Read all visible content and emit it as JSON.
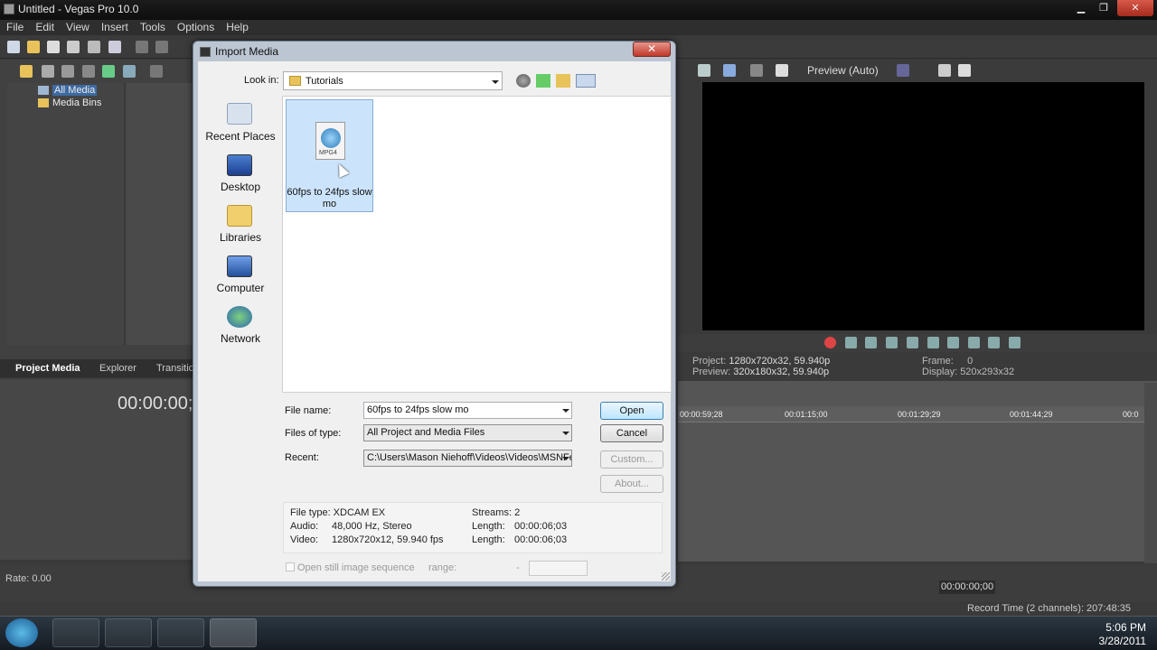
{
  "app": {
    "title": "Untitled - Vegas Pro 10.0"
  },
  "menu": [
    "File",
    "Edit",
    "View",
    "Insert",
    "Tools",
    "Options",
    "Help"
  ],
  "left_panel": {
    "tree": [
      "All Media",
      "Media Bins"
    ],
    "tabs": [
      "Project Media",
      "Explorer",
      "Transitio"
    ],
    "timecode": "00:00:00;",
    "rate": "Rate: 0.00"
  },
  "preview": {
    "mode": "Preview (Auto)",
    "project_label": "Project:",
    "project_value": "1280x720x32, 59.940p",
    "preview_label": "Preview:",
    "preview_value": "320x180x32, 59.940p",
    "frame_label": "Frame:",
    "frame_value": "0",
    "display_label": "Display:",
    "display_value": "520x293x32"
  },
  "timeline": {
    "ruler": [
      "00:00:59;28",
      "00:01:15;00",
      "00:01:29;29",
      "00:01:44;29",
      "00:0"
    ],
    "timecode": "00:00:00;00",
    "record_time": "Record Time (2 channels): 207:48:35"
  },
  "dialog": {
    "title": "Import Media",
    "close": "✕",
    "look_in_label": "Look in:",
    "look_in_value": "Tutorials",
    "places": [
      "Recent Places",
      "Desktop",
      "Libraries",
      "Computer",
      "Network"
    ],
    "file": {
      "name": "60fps to 24fps slow mo",
      "badge": "MPG4"
    },
    "file_name_label": "File name:",
    "file_name_value": "60fps to 24fps slow mo",
    "files_of_type_label": "Files of type:",
    "files_of_type_value": "All Project and Media Files",
    "recent_label": "Recent:",
    "recent_value": "C:\\Users\\Mason Niehoff\\Videos\\Videos\\MSNFe",
    "buttons": {
      "open": "Open",
      "cancel": "Cancel",
      "custom": "Custom...",
      "about": "About..."
    },
    "info": {
      "file_type": "File type: XDCAM EX",
      "audio_label": "Audio:",
      "audio_value": "48,000 Hz, Stereo",
      "video_label": "Video:",
      "video_value": "1280x720x12, 59.940 fps",
      "streams": "Streams:  2",
      "length1_label": "Length:",
      "length1_value": "00:00:06;03",
      "length2_label": "Length:",
      "length2_value": "00:00:06;03"
    },
    "still_sequence": "Open still image sequence",
    "range_label": "range:",
    "range_dash": "-"
  },
  "taskbar": {
    "time": "5:06 PM",
    "date": "3/28/2011"
  }
}
